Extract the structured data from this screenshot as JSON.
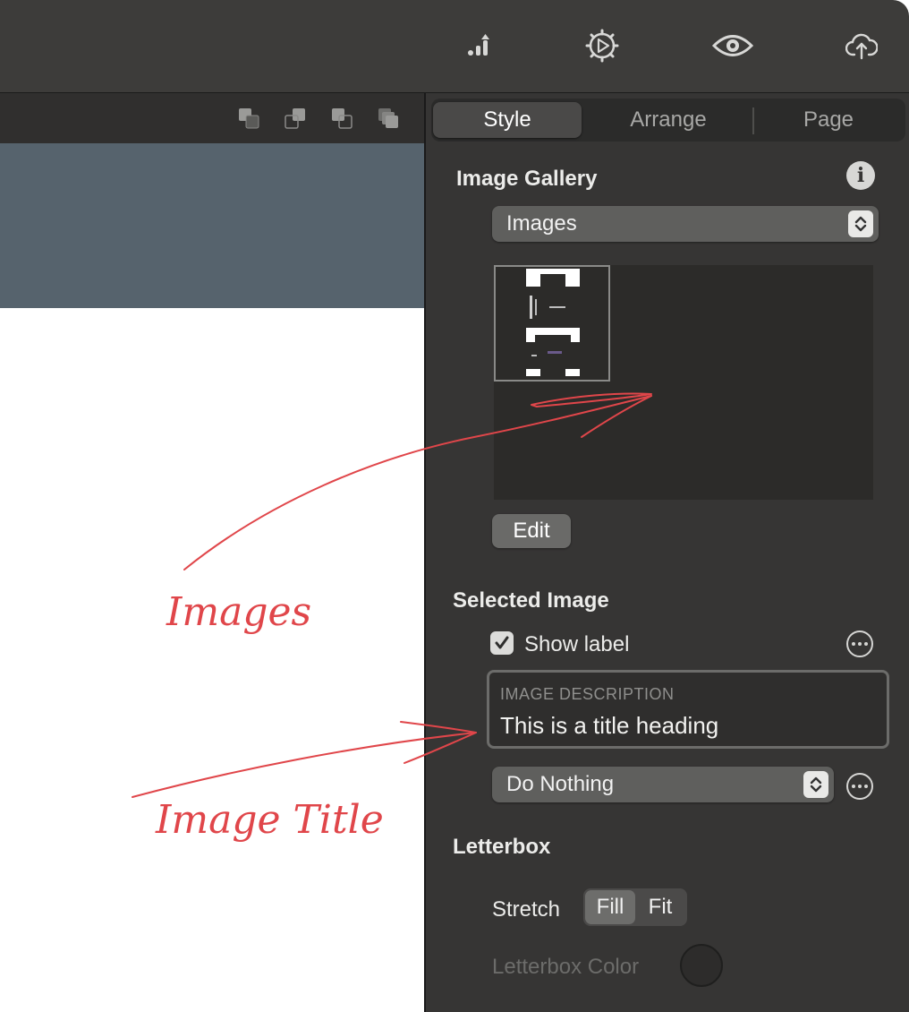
{
  "toolbar": {
    "icons": [
      "stats-icon",
      "settings-icon",
      "preview-icon",
      "upload-icon"
    ]
  },
  "canvas_bar": {
    "icons": [
      "send-to-back-icon",
      "send-backward-icon",
      "bring-forward-icon",
      "bring-to-front-icon"
    ]
  },
  "inspector": {
    "tabs": [
      {
        "label": "Style",
        "active": true
      },
      {
        "label": "Arrange",
        "active": false
      },
      {
        "label": "Page",
        "active": false
      }
    ],
    "gallery": {
      "title": "Image Gallery",
      "source_value": "Images",
      "edit_label": "Edit"
    },
    "selected_image": {
      "title": "Selected Image",
      "show_label_text": "Show label",
      "show_label_checked": true,
      "description_label": "IMAGE DESCRIPTION",
      "description_value": "This is a title heading",
      "action_value": "Do Nothing"
    },
    "letterbox": {
      "title": "Letterbox",
      "stretch_label": "Stretch",
      "options": [
        "Fill",
        "Fit"
      ],
      "selected": "Fill",
      "color_label": "Letterbox Color"
    }
  },
  "annotations": {
    "images_label": "Images",
    "image_title_label": "Image Title",
    "ink_color": "#e0464a"
  }
}
